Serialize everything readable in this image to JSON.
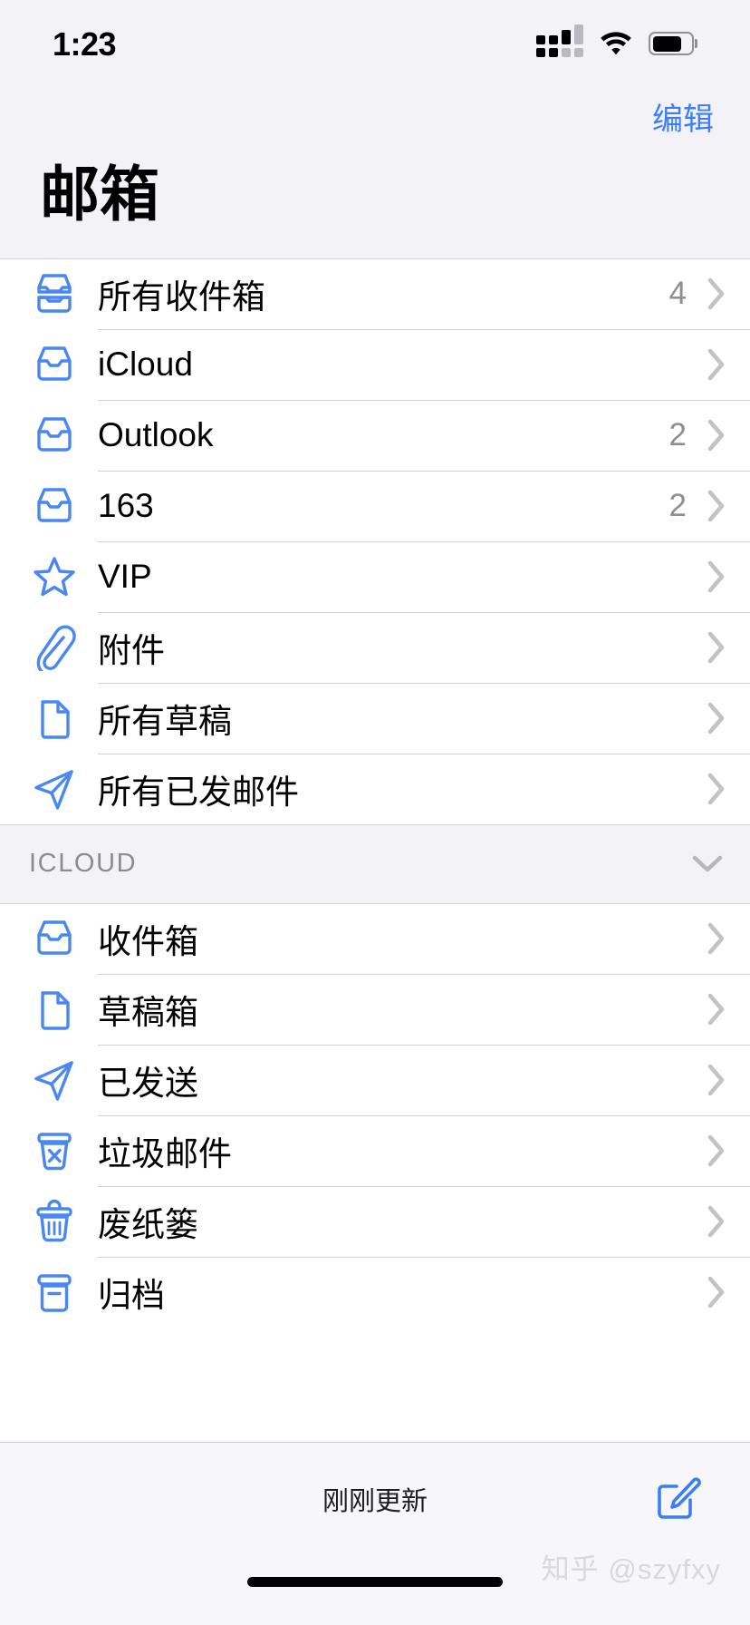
{
  "status_bar": {
    "time": "1:23",
    "cellular_icon": "cellular-signal-icon",
    "wifi_icon": "wifi-icon",
    "battery_icon": "battery-icon"
  },
  "nav": {
    "edit_label": "编辑",
    "title": "邮箱"
  },
  "colors": {
    "accent": "#3c7dfd",
    "icon_blue": "#4a87f2",
    "secondary_text": "#8e8e93",
    "group_bg": "#f2f2f7",
    "row_bg": "#ffffff",
    "separator": "#d1d1d4"
  },
  "mailbox_list": [
    {
      "label": "所有收件箱",
      "count": "4",
      "icon": "inbox-stack-icon",
      "chevron": "chevron-right-icon"
    },
    {
      "label": "iCloud",
      "count": "",
      "icon": "inbox-icon",
      "chevron": "chevron-right-icon"
    },
    {
      "label": "Outlook",
      "count": "2",
      "icon": "inbox-icon",
      "chevron": "chevron-right-icon"
    },
    {
      "label": "163",
      "count": "2",
      "icon": "inbox-icon",
      "chevron": "chevron-right-icon"
    },
    {
      "label": "VIP",
      "count": "",
      "icon": "star-icon",
      "chevron": "chevron-right-icon"
    },
    {
      "label": "附件",
      "count": "",
      "icon": "paperclip-icon",
      "chevron": "chevron-right-icon"
    },
    {
      "label": "所有草稿",
      "count": "",
      "icon": "document-icon",
      "chevron": "chevron-right-icon"
    },
    {
      "label": "所有已发邮件",
      "count": "",
      "icon": "paper-plane-icon",
      "chevron": "chevron-right-icon"
    }
  ],
  "icloud_section": {
    "header": "ICLOUD",
    "collapse_icon": "chevron-down-icon",
    "items": [
      {
        "label": "收件箱",
        "count": "",
        "icon": "inbox-icon",
        "chevron": "chevron-right-icon"
      },
      {
        "label": "草稿箱",
        "count": "",
        "icon": "document-icon",
        "chevron": "chevron-right-icon"
      },
      {
        "label": "已发送",
        "count": "",
        "icon": "paper-plane-icon",
        "chevron": "chevron-right-icon"
      },
      {
        "label": "垃圾邮件",
        "count": "",
        "icon": "junk-bin-icon",
        "chevron": "chevron-right-icon"
      },
      {
        "label": "废纸篓",
        "count": "",
        "icon": "trash-icon",
        "chevron": "chevron-right-icon"
      },
      {
        "label": "归档",
        "count": "",
        "icon": "archive-box-icon",
        "chevron": "chevron-right-icon"
      }
    ]
  },
  "toolbar": {
    "status_text": "刚刚更新",
    "compose_icon": "compose-icon"
  },
  "watermark": "知乎 @szyfxy"
}
